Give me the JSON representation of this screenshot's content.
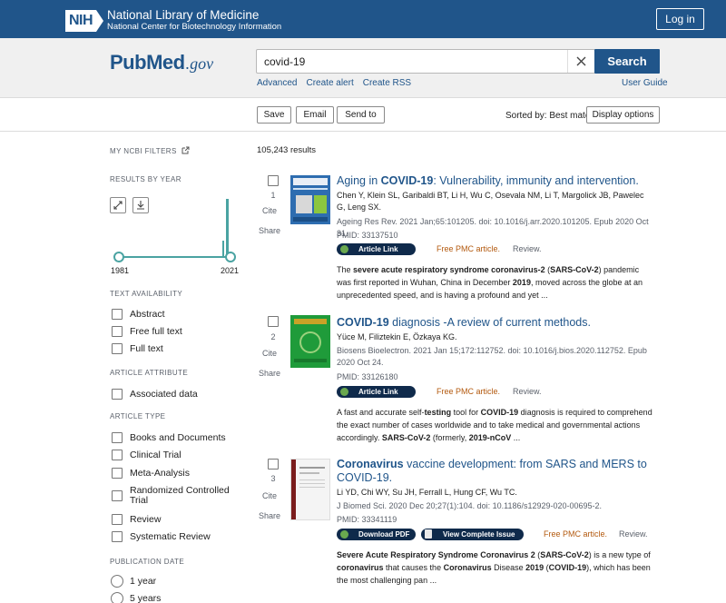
{
  "header": {
    "org_abbrev": "NIH",
    "org_title": "National Library of Medicine",
    "org_subtitle": "National Center for Biotechnology Information",
    "login_label": "Log in"
  },
  "search": {
    "logo_pub": "Pub",
    "logo_med": "Med",
    "logo_gov": ".gov",
    "query": "covid-19",
    "button_label": "Search",
    "links": [
      "Advanced",
      "Create alert",
      "Create RSS"
    ],
    "user_guide": "User Guide"
  },
  "toolbar": {
    "save": "Save",
    "email": "Email",
    "send_to": "Send to",
    "sorted_by": "Sorted by: Best match",
    "display_options": "Display options"
  },
  "sidebar": {
    "my_ncbi_filters": "MY NCBI FILTERS",
    "results_by_year": "RESULTS BY YEAR",
    "year_start": "1981",
    "year_end": "2021",
    "text_availability": "TEXT AVAILABILITY",
    "text_options": [
      "Abstract",
      "Free full text",
      "Full text"
    ],
    "article_attribute": "ARTICLE ATTRIBUTE",
    "attribute_options": [
      "Associated data"
    ],
    "article_type": "ARTICLE TYPE",
    "type_options": [
      "Books and Documents",
      "Clinical Trial",
      "Meta-Analysis",
      "Randomized Controlled Trial",
      "Review",
      "Systematic Review"
    ],
    "publication_date": "PUBLICATION DATE",
    "date_options": [
      "1 year",
      "5 years"
    ]
  },
  "results": {
    "count": "105,243 results",
    "cite_label": "Cite",
    "share_label": "Share",
    "free_pmc": "Free PMC article.",
    "review_label": "Review.",
    "items": [
      {
        "num": "1",
        "title_pre": "Aging in ",
        "title_bold": "COVID-19",
        "title_post": ": Vulnerability, immunity and intervention.",
        "authors": "Chen Y, Klein SL, Garibaldi BT, Li H, Wu C, Osevala NM, Li T, Margolick JB, Pawelec G, Leng SX.",
        "journal": "Ageing Res Rev. 2021 Jan;65:101205. doi: 10.1016/j.arr.2020.101205. Epub 2020 Oct 31.",
        "pmid": "PMID: 33137510",
        "link1": "Article Link",
        "snippet_parts": [
          [
            "The ",
            false
          ],
          [
            "severe acute respiratory syndrome coronavirus-2",
            true
          ],
          [
            " (",
            false
          ],
          [
            "SARS-CoV-2",
            true
          ],
          [
            ") pandemic was first reported in Wuhan, China in December ",
            false
          ],
          [
            "2019",
            true
          ],
          [
            ", moved across the globe at an unprecedented speed, and is having a profound and yet ...",
            false
          ]
        ],
        "thumb_colors": [
          "#2e6db0",
          "#d8d8d8",
          "#8cc63f"
        ]
      },
      {
        "num": "2",
        "title_pre": "",
        "title_bold": "COVID-19",
        "title_post": " diagnosis -A review of current methods.",
        "authors": "Yüce M, Filiztekin E, Özkaya KG.",
        "journal": "Biosens Bioelectron. 2021 Jan 15;172:112752. doi: 10.1016/j.bios.2020.112752. Epub 2020 Oct 24.",
        "pmid": "PMID: 33126180",
        "link1": "Article Link",
        "snippet_parts": [
          [
            "A fast and accurate self-",
            false
          ],
          [
            "testing",
            true
          ],
          [
            " tool for ",
            false
          ],
          [
            "COVID-19",
            true
          ],
          [
            " diagnosis is required to comprehend the exact number of cases worldwide and to take medical and governmental actions accordingly. ",
            false
          ],
          [
            "SARS-CoV-2",
            true
          ],
          [
            " (formerly, ",
            false
          ],
          [
            "2019-nCoV",
            true
          ],
          [
            " ...",
            false
          ]
        ],
        "thumb_colors": [
          "#1f9b3a",
          "#c9a227"
        ]
      },
      {
        "num": "3",
        "title_pre": "",
        "title_bold": "Coronavirus",
        "title_post": " vaccine development: from SARS and MERS to COVID-19.",
        "authors": "Li YD, Chi WY, Su JH, Ferrall L, Hung CF, Wu TC.",
        "journal": "J Biomed Sci. 2020 Dec 20;27(1):104. doi: 10.1186/s12929-020-00695-2.",
        "pmid": "PMID: 33341119",
        "link1": "Download PDF",
        "link2": "View Complete Issue",
        "snippet_parts": [
          [
            "Severe Acute Respiratory Syndrome Coronavirus 2",
            true
          ],
          [
            " (",
            false
          ],
          [
            "SARS-CoV-2",
            true
          ],
          [
            ") is a new type of ",
            false
          ],
          [
            "coronavirus",
            true
          ],
          [
            " that causes the ",
            false
          ],
          [
            "Coronavirus",
            true
          ],
          [
            " Disease ",
            false
          ],
          [
            "2019",
            true
          ],
          [
            " (",
            false
          ],
          [
            "COVID-19",
            true
          ],
          [
            "), which has been the most challenging pan ...",
            false
          ]
        ],
        "thumb_colors": [
          "#7a1c1c",
          "#f4f4f4"
        ]
      }
    ]
  },
  "colors": {
    "nih_blue": "#20558a",
    "link_blue": "#20558a",
    "free_pmc_orange": "#b3590e",
    "pill_navy": "#0f2a4b",
    "timeline_teal": "#4aa3a2"
  },
  "icons": [
    "nih-logo-icon",
    "clear-icon",
    "external-link-icon",
    "expand-icon",
    "download-icon",
    "leaf-icon",
    "pdf-icon",
    "issue-icon"
  ]
}
